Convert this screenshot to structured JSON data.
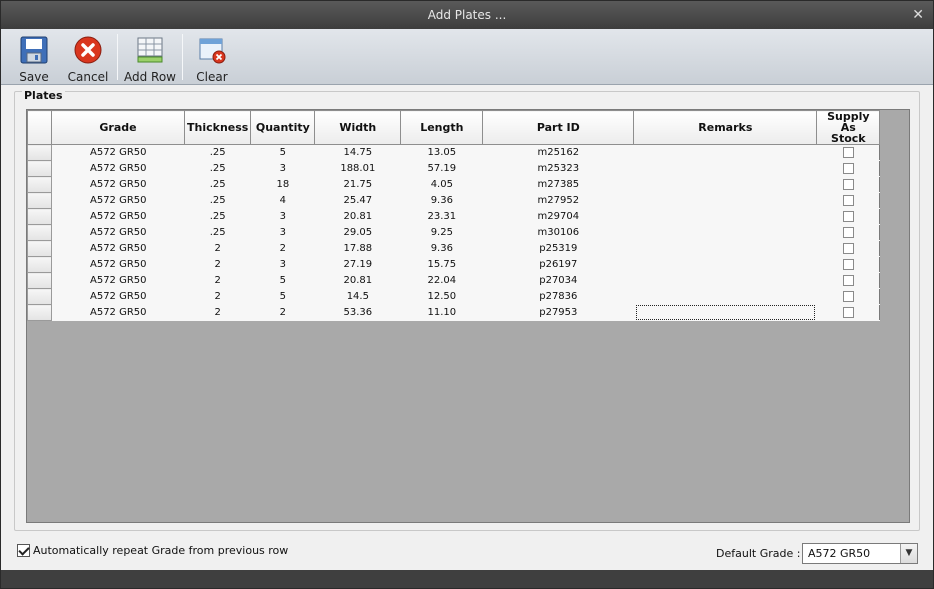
{
  "window": {
    "title": "Add Plates ...",
    "close_symbol": "✕"
  },
  "toolbar": {
    "save_label": "Save",
    "cancel_label": "Cancel",
    "add_row_label": "Add Row",
    "clear_label": "Clear",
    "icons": [
      "save-icon",
      "cancel-icon",
      "add-row-icon",
      "clear-icon"
    ]
  },
  "plates": {
    "group_title": "Plates",
    "columns": [
      "Grade",
      "Thickness",
      "Quantity",
      "Width",
      "Length",
      "Part ID",
      "Remarks",
      "Supply As Stock"
    ],
    "supply_line1": "Supply As",
    "supply_line2": "Stock",
    "rows": [
      {
        "grade": "A572 GR50",
        "thickness": ".25",
        "quantity": "5",
        "width": "14.75",
        "length": "13.05",
        "part_id": "m25162",
        "remarks": "",
        "supply_as_stock": false
      },
      {
        "grade": "A572 GR50",
        "thickness": ".25",
        "quantity": "3",
        "width": "188.01",
        "length": "57.19",
        "part_id": "m25323",
        "remarks": "",
        "supply_as_stock": false
      },
      {
        "grade": "A572 GR50",
        "thickness": ".25",
        "quantity": "18",
        "width": "21.75",
        "length": "4.05",
        "part_id": "m27385",
        "remarks": "",
        "supply_as_stock": false
      },
      {
        "grade": "A572 GR50",
        "thickness": ".25",
        "quantity": "4",
        "width": "25.47",
        "length": "9.36",
        "part_id": "m27952",
        "remarks": "",
        "supply_as_stock": false
      },
      {
        "grade": "A572 GR50",
        "thickness": ".25",
        "quantity": "3",
        "width": "20.81",
        "length": "23.31",
        "part_id": "m29704",
        "remarks": "",
        "supply_as_stock": false
      },
      {
        "grade": "A572 GR50",
        "thickness": ".25",
        "quantity": "3",
        "width": "29.05",
        "length": "9.25",
        "part_id": "m30106",
        "remarks": "",
        "supply_as_stock": false
      },
      {
        "grade": "A572 GR50",
        "thickness": "2",
        "quantity": "2",
        "width": "17.88",
        "length": "9.36",
        "part_id": "p25319",
        "remarks": "",
        "supply_as_stock": false
      },
      {
        "grade": "A572 GR50",
        "thickness": "2",
        "quantity": "3",
        "width": "27.19",
        "length": "15.75",
        "part_id": "p26197",
        "remarks": "",
        "supply_as_stock": false
      },
      {
        "grade": "A572 GR50",
        "thickness": "2",
        "quantity": "5",
        "width": "20.81",
        "length": "22.04",
        "part_id": "p27034",
        "remarks": "",
        "supply_as_stock": false
      },
      {
        "grade": "A572 GR50",
        "thickness": "2",
        "quantity": "5",
        "width": "14.5",
        "length": "12.50",
        "part_id": "p27836",
        "remarks": "",
        "supply_as_stock": false
      },
      {
        "grade": "A572 GR50",
        "thickness": "2",
        "quantity": "2",
        "width": "53.36",
        "length": "11.10",
        "part_id": "p27953",
        "remarks": "",
        "supply_as_stock": false
      }
    ]
  },
  "footer": {
    "repeat_grade_label": "Automatically repeat Grade from previous row",
    "repeat_grade_checked": true,
    "default_grade_label": "Default Grade :",
    "default_grade_value": "A572 GR50"
  },
  "colors": {
    "titlebar": "#3d3d3d",
    "grid_background": "#a9a9a9",
    "cancel_red": "#d9361e",
    "save_blue": "#3f6fb8"
  }
}
